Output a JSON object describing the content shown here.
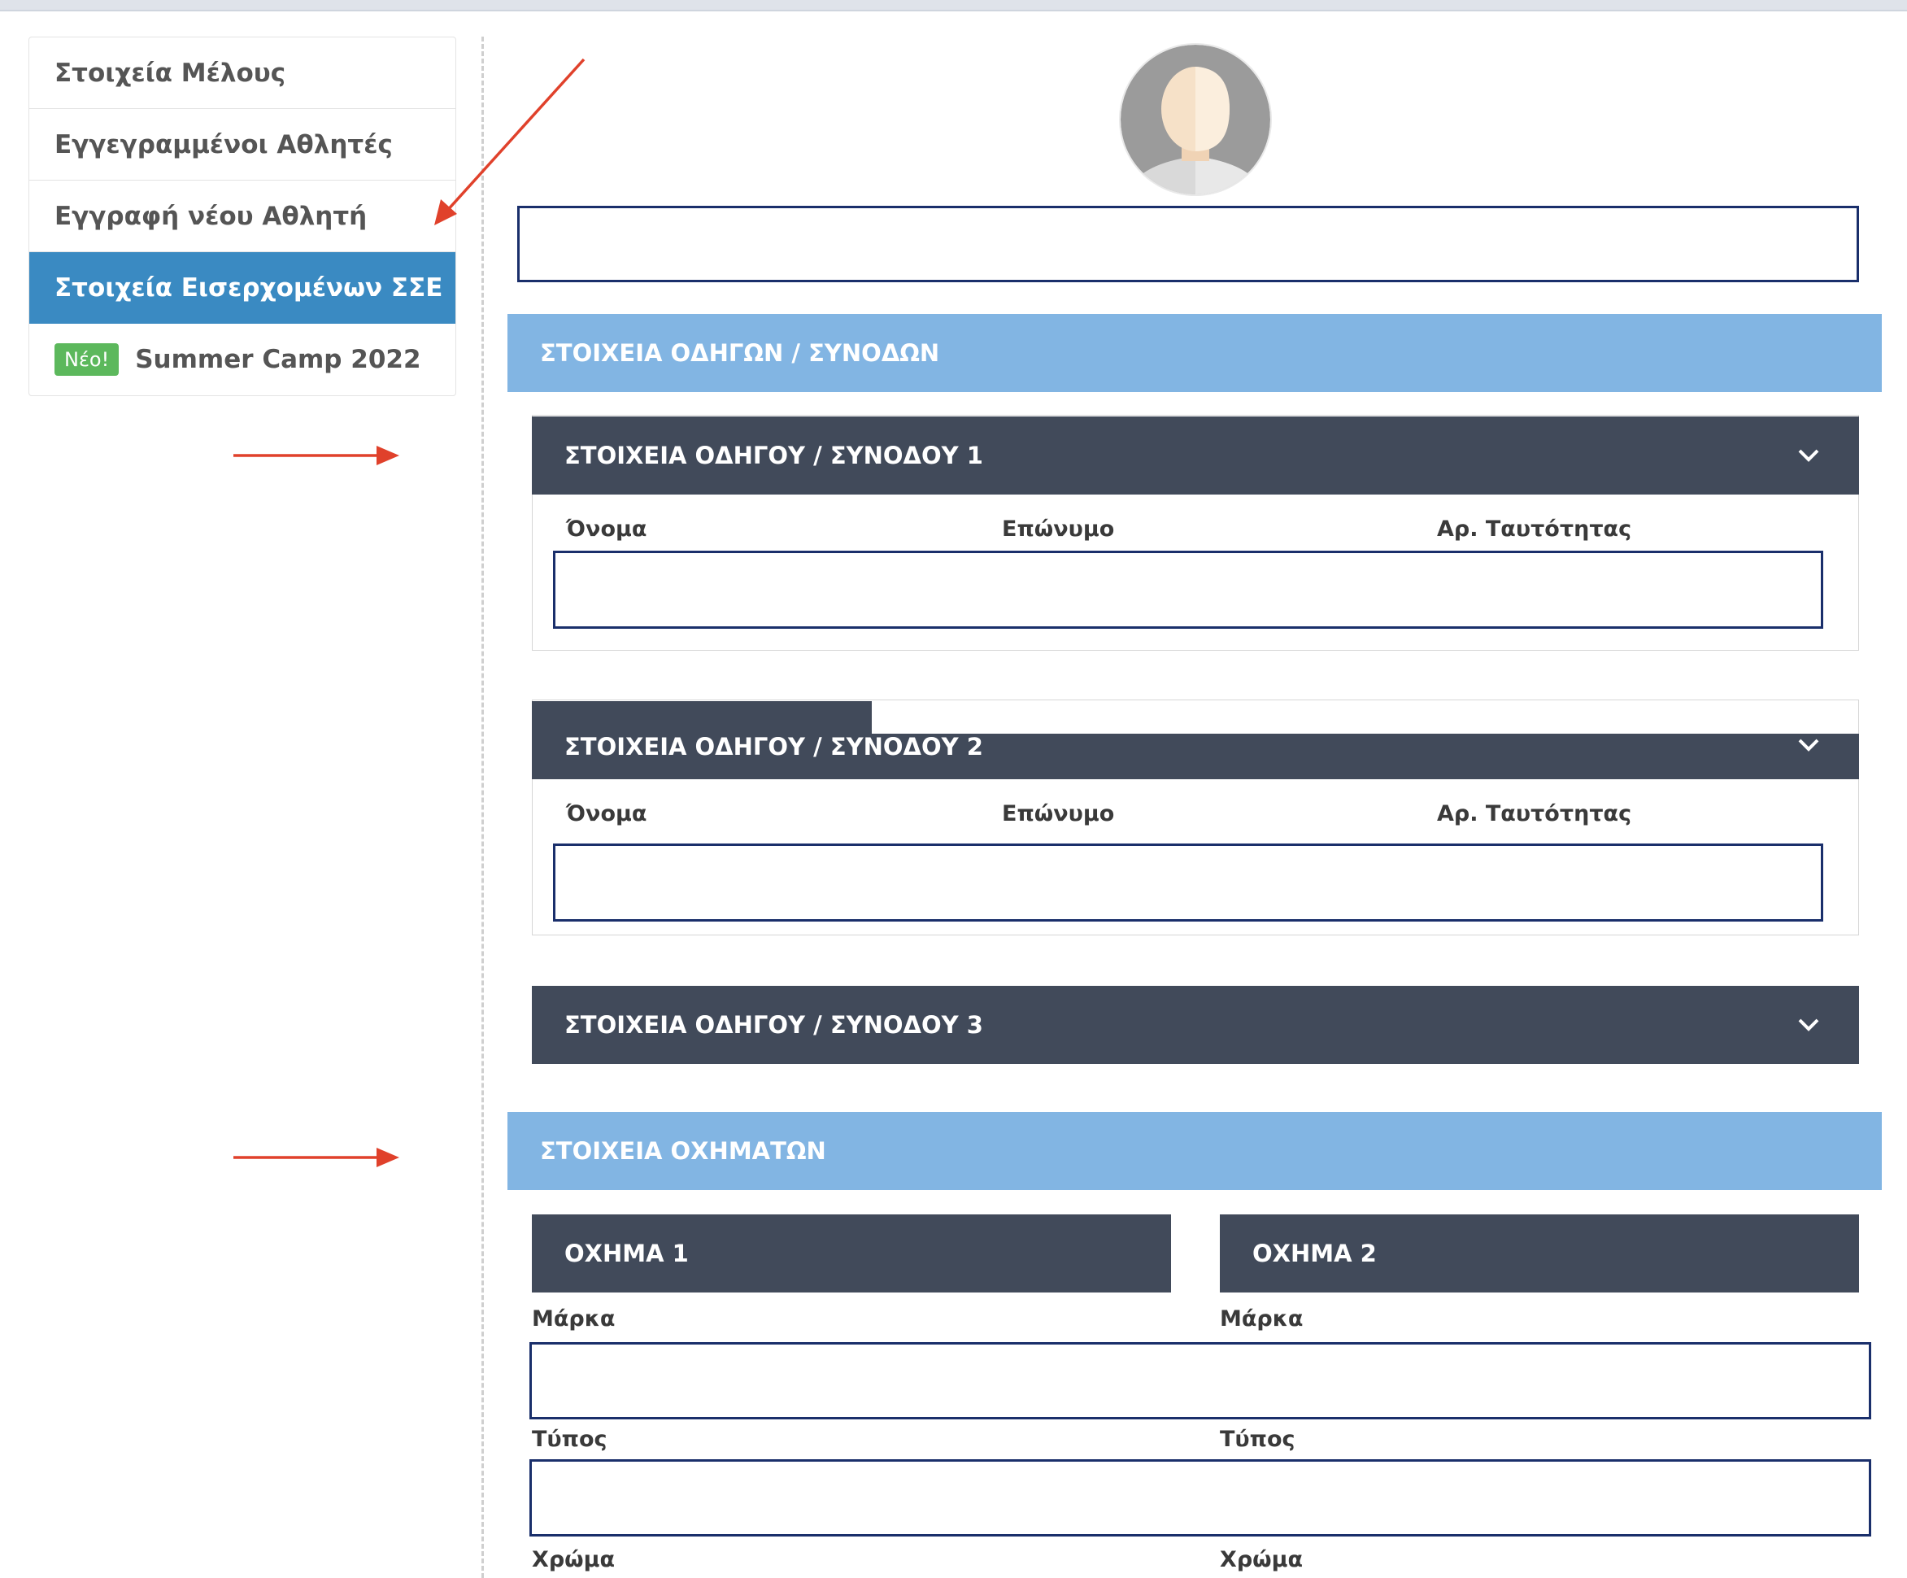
{
  "sidebar": {
    "items": [
      {
        "label": "Στοιχεία Μέλους"
      },
      {
        "label": "Εγγεγραμμένοι Αθλητές"
      },
      {
        "label": "Εγγραφή νέου Αθλητή"
      },
      {
        "label": "Στοιχεία Εισερχομένων ΣΣΕ"
      },
      {
        "label": "Summer Camp 2022",
        "badge": "Νέο!"
      }
    ]
  },
  "drivers_section": {
    "title": "ΣΤΟΙΧΕΙΑ ΟΔΗΓΩΝ / ΣΥΝΟΔΩΝ",
    "panels": [
      {
        "title": "ΣΤΟΙΧΕΙΑ ΟΔΗΓΟΥ / ΣΥΝΟΔΟΥ 1",
        "labels": {
          "first": "Όνομα",
          "last": "Επώνυμο",
          "id": "Αρ. Ταυτότητας"
        }
      },
      {
        "title": "ΣΤΟΙΧΕΙΑ ΟΔΗΓΟΥ / ΣΥΝΟΔΟΥ 2",
        "labels": {
          "first": "Όνομα",
          "last": "Επώνυμο",
          "id": "Αρ. Ταυτότητας"
        }
      },
      {
        "title": "ΣΤΟΙΧΕΙΑ ΟΔΗΓΟΥ / ΣΥΝΟΔΟΥ 3"
      }
    ]
  },
  "vehicles_section": {
    "title": "ΣΤΟΙΧΕΙΑ ΟΧΗΜΑΤΩΝ",
    "vehicles": [
      {
        "title": "ΟΧΗΜΑ 1",
        "brand_label": "Μάρκα",
        "type_label": "Τύπος",
        "color_label": "Χρώμα"
      },
      {
        "title": "ΟΧΗΜΑ 2",
        "brand_label": "Μάρκα",
        "type_label": "Τύπος",
        "color_label": "Χρώμα"
      }
    ]
  },
  "colors": {
    "accent": "#3a8ac2",
    "section_header": "#82b5e3",
    "panel_header": "#414a5a",
    "input_border": "#1a2f6b",
    "badge": "#5cb85c",
    "annotation": "#e0412b"
  }
}
